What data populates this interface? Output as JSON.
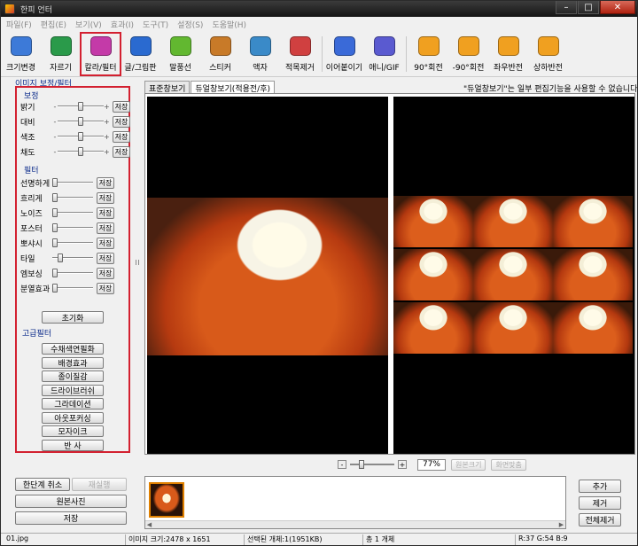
{
  "window": {
    "title": "한피 언터"
  },
  "menu": [
    "파일(F)",
    "편집(E)",
    "보기(V)",
    "효과(I)",
    "도구(T)",
    "설정(S)",
    "도움말(H)"
  ],
  "toolbar": [
    {
      "label": "크기변경",
      "icon": "resize-icon",
      "color": "#3d7ad8"
    },
    {
      "label": "자르기",
      "icon": "crop-icon",
      "color": "#2a9a4a"
    },
    {
      "label": "칼라/필터",
      "icon": "color-filter-icon",
      "color": "#c43aa8",
      "selected": true
    },
    {
      "label": "글/그림판",
      "icon": "text-draw-icon",
      "color": "#2a6ad0"
    },
    {
      "label": "말풍선",
      "icon": "speech-bubble-icon",
      "color": "#62b830"
    },
    {
      "label": "스티커",
      "icon": "sticker-icon",
      "color": "#c87a28"
    },
    {
      "label": "액자",
      "icon": "frame-icon",
      "color": "#3a8ac8"
    },
    {
      "label": "적목제거",
      "icon": "red-eye-icon",
      "color": "#d04040"
    },
    {
      "label": "이어붙이기",
      "icon": "merge-icon",
      "color": "#3a6ad8"
    },
    {
      "label": "애니/GIF",
      "icon": "gif-icon",
      "color": "#5a5ad0"
    },
    {
      "label": "90°회전",
      "icon": "rotate-cw-icon",
      "color": "#f0a020"
    },
    {
      "label": "-90°회전",
      "icon": "rotate-ccw-icon",
      "color": "#f0a020"
    },
    {
      "label": "좌우반전",
      "icon": "flip-horizontal-icon",
      "color": "#f0a020"
    },
    {
      "label": "상하반전",
      "icon": "flip-vertical-icon",
      "color": "#f0a020"
    }
  ],
  "left_panel": {
    "header": "이미지 보정/필터",
    "correction_title": "보정",
    "corrections": [
      {
        "label": "밝기",
        "value": 0.5
      },
      {
        "label": "대비",
        "value": 0.5
      },
      {
        "label": "색조",
        "value": 0.5
      },
      {
        "label": "채도",
        "value": 0.5
      }
    ],
    "filter_title": "필터",
    "filters": [
      {
        "label": "선명하게",
        "value": 0.0
      },
      {
        "label": "흐리게",
        "value": 0.0
      },
      {
        "label": "노이즈",
        "value": 0.0
      },
      {
        "label": "포스터",
        "value": 0.0
      },
      {
        "label": "뽀샤시",
        "value": 0.0
      },
      {
        "label": "타일",
        "value": 0.15
      },
      {
        "label": "엠보싱",
        "value": 0.0
      },
      {
        "label": "분열효과",
        "value": 0.0
      }
    ],
    "save_label": "저장",
    "reset_label": "초기화",
    "advanced_title": "고급필터",
    "advanced": [
      "수채색연필화",
      "배경효과",
      "종이질감",
      "드라이브러쉬",
      "그라데이션",
      "아웃포커싱",
      "모자이크",
      "반      사"
    ]
  },
  "tabs": [
    {
      "label": "표준창보기",
      "active": false
    },
    {
      "label": "듀얼창보기(적용전/후)",
      "active": true
    }
  ],
  "notice": "\"듀얼창보기\"는 일부 편집기능을 사용할 수 없습니다",
  "zoom": {
    "value": "77%",
    "minus": "-",
    "plus": "+",
    "original_size": "원본크기",
    "fit_screen": "화면맞춤"
  },
  "bottom_left": {
    "undo": "한단계 취소",
    "redo": "재실행",
    "original": "원본사진",
    "save": "저장"
  },
  "bottom_right": {
    "add": "추가",
    "remove": "제거",
    "remove_all": "전체제거"
  },
  "status": {
    "file": "01.jpg",
    "image_size": "이미지 크기:2478 x 1651",
    "selected": "선택된 개체:1(1951KB)",
    "total": "총 1 개체",
    "rgb": "R:37 G:54 B:9"
  }
}
